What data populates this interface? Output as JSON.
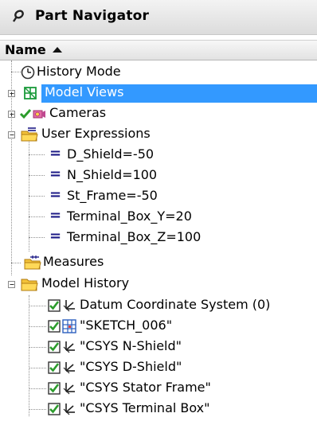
{
  "panel": {
    "title": "Part Navigator",
    "column_header": "Name"
  },
  "tree": {
    "history_mode": "History Mode",
    "model_views": "Model Views",
    "cameras": "Cameras",
    "user_expressions": "User Expressions",
    "expressions": [
      "D_Shield=-50",
      "N_Shield=100",
      "St_Frame=-50",
      "Terminal_Box_Y=20",
      "Terminal_Box_Z=100"
    ],
    "measures": "Measures",
    "model_history": "Model History",
    "features": [
      "Datum Coordinate System (0)",
      "\"SKETCH_006\"",
      "\"CSYS N-Shield\"",
      "\"CSYS D-Shield\"",
      "\"CSYS Stator Frame\"",
      "\"CSYS Terminal Box\""
    ]
  },
  "colors": {
    "selection": "#3399ff",
    "expression_equals": "#1c1a86",
    "check": "#2c9c2c"
  }
}
